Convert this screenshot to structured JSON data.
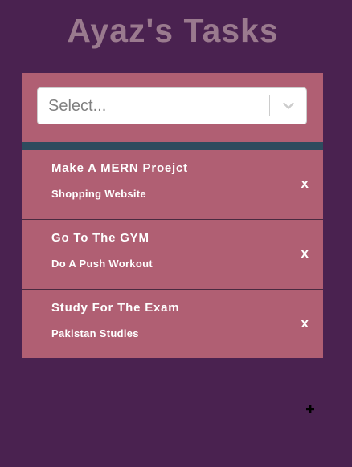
{
  "app": {
    "title": "Ayaz's Tasks"
  },
  "select": {
    "placeholder": "Select...",
    "chevron_icon": "chevron-down-icon"
  },
  "tasks": [
    {
      "title": "Make A MERN Proejct",
      "description": "Shopping Website",
      "delete_label": "x"
    },
    {
      "title": "Go To The GYM",
      "description": "Do A Push Workout",
      "delete_label": "x"
    },
    {
      "title": "Study For The Exam",
      "description": "Pakistan Studies",
      "delete_label": "x"
    }
  ],
  "add_button": {
    "icon": "plus-icon"
  },
  "colors": {
    "background": "#4a2250",
    "title": "#9a7a8e",
    "panel": "#b05f73",
    "divider": "#2e4b5e",
    "text": "#ffffff"
  }
}
